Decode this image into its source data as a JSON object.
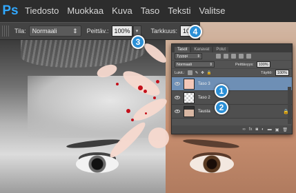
{
  "menubar": {
    "logo": "Ps",
    "items": [
      "Tiedosto",
      "Muokkaa",
      "Kuva",
      "Taso",
      "Teksti",
      "Valitse"
    ]
  },
  "optionsbar": {
    "mode_label": "Tila:",
    "mode_value": "Normaali",
    "opacity_label": "Peittäv.:",
    "opacity_value": "100%",
    "flow_label": "Tarkkuus:",
    "flow_value": "100"
  },
  "callouts": [
    "1",
    "2",
    "3",
    "4"
  ],
  "layers_panel": {
    "tabs": [
      "Tasot",
      "Kanavat",
      "Polut"
    ],
    "filter_label": "Tyyppi",
    "blend_mode": "Normaali",
    "opacity_label": "Peittävyys:",
    "opacity_value": "100%",
    "lock_label": "Lukit.:",
    "fill_label": "Täyttö:",
    "fill_value": "100%",
    "layers": [
      {
        "name": "Taso 3",
        "selected": true
      },
      {
        "name": "Taso 2",
        "selected": false
      },
      {
        "name": "Tausta",
        "selected": false
      }
    ],
    "footer_icons": [
      "link-icon",
      "fx-icon",
      "mask-icon",
      "adjustment-icon",
      "folder-icon",
      "new-layer-icon",
      "trash-icon"
    ]
  },
  "colors": {
    "accent": "#2b8fd6",
    "ps_blue": "#31a8ff",
    "splash_red": "#c3101b",
    "selected_layer": "#6e8fb5"
  }
}
